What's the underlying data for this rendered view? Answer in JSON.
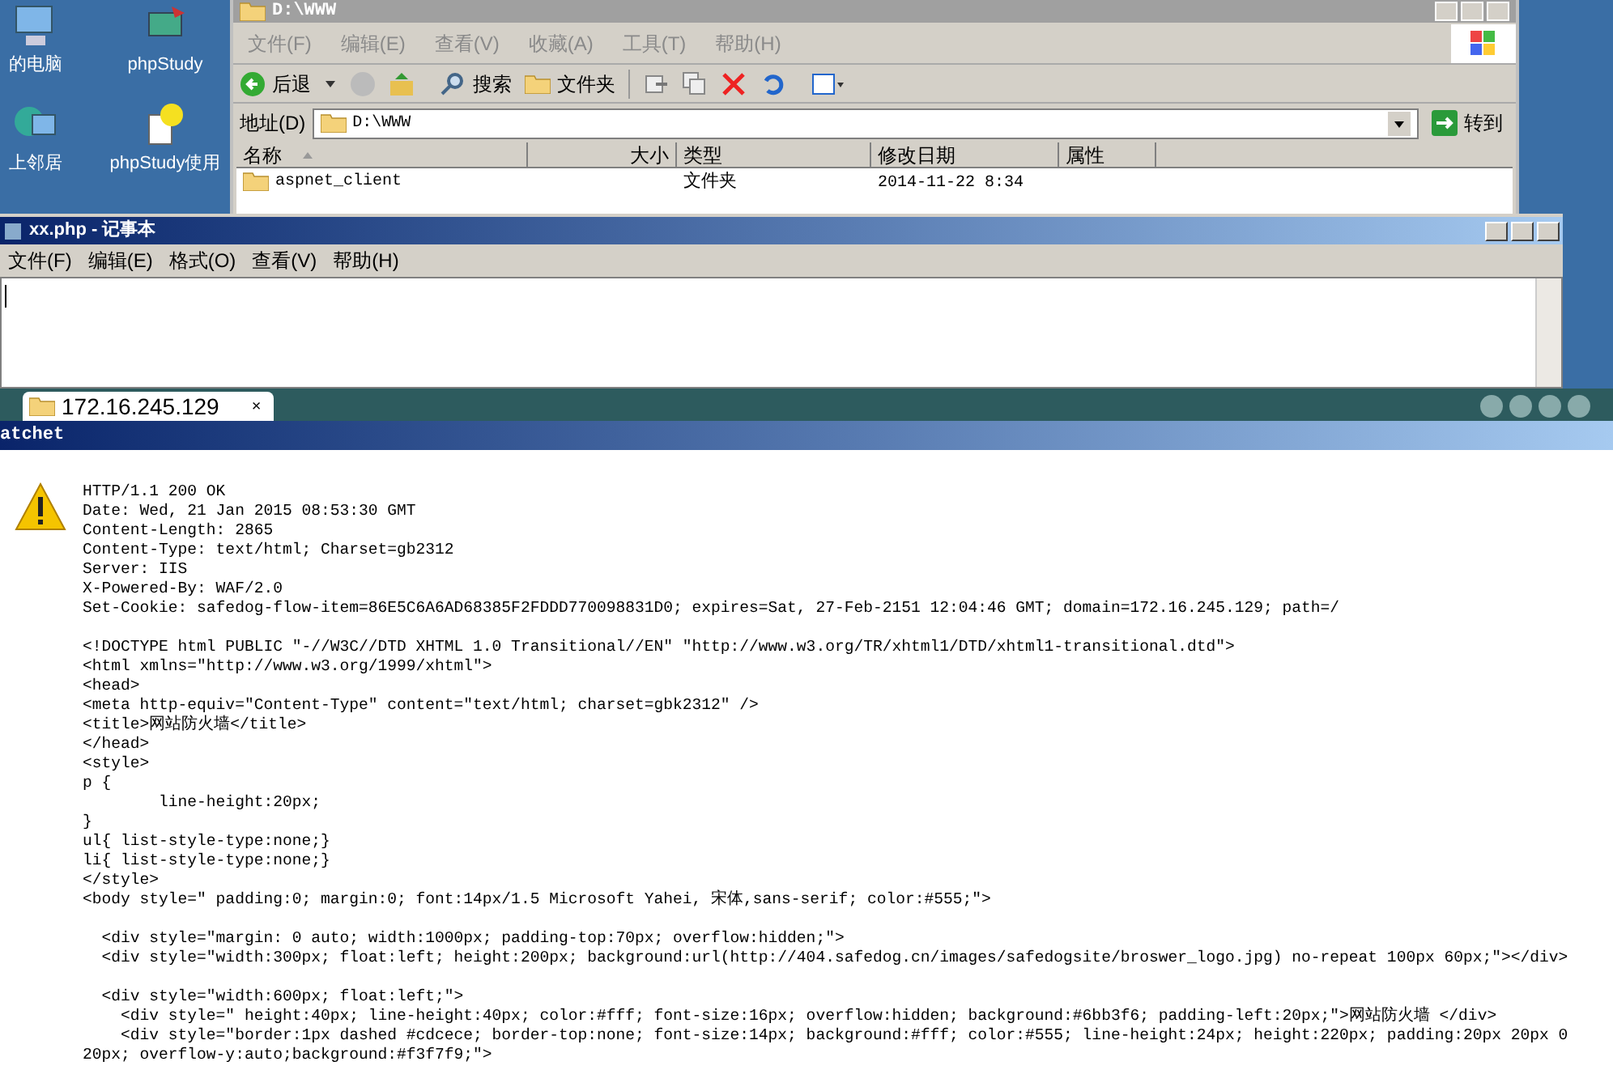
{
  "desktop_icons": [
    {
      "label": "的电脑"
    },
    {
      "label": "phpStudy"
    },
    {
      "label": "上邻居"
    },
    {
      "label": "phpStudy使用"
    }
  ],
  "explorer": {
    "title": "D:\\WWW",
    "menu": [
      "文件(F)",
      "编辑(E)",
      "查看(V)",
      "收藏(A)",
      "工具(T)",
      "帮助(H)"
    ],
    "toolbar": {
      "back": "后退",
      "search": "搜索",
      "folders": "文件夹"
    },
    "address": {
      "label": "地址(D)",
      "value": "D:\\WWW",
      "go": "转到"
    },
    "columns": [
      "名称",
      "大小",
      "类型",
      "修改日期",
      "属性"
    ],
    "rows": [
      {
        "name": "aspnet_client",
        "size": "",
        "type": "文件夹",
        "modified": "2014-11-22 8:34"
      }
    ]
  },
  "notepad": {
    "title": "xx.php - 记事本",
    "menu": [
      "文件(F)",
      "编辑(E)",
      "格式(O)",
      "查看(V)",
      "帮助(H)"
    ]
  },
  "browser": {
    "tab": {
      "label": "172.16.245.129",
      "close": "×"
    },
    "title": "atchet"
  },
  "response": {
    "blocks": [
      [
        "HTTP/1.1 200 OK",
        "Date: Wed, 21 Jan 2015 08:53:30 GMT",
        "Content-Length: 2865",
        "Content-Type: text/html; Charset=gb2312",
        "Server: IIS",
        "X-Powered-By: WAF/2.0",
        "Set-Cookie: safedog-flow-item=86E5C6A6AD68385F2FDDD770098831D0; expires=Sat, 27-Feb-2151 12:04:46 GMT; domain=172.16.245.129; path=/"
      ],
      [
        "<!DOCTYPE html PUBLIC \"-//W3C//DTD XHTML 1.0 Transitional//EN\" \"http://www.w3.org/TR/xhtml1/DTD/xhtml1-transitional.dtd\">",
        "<html xmlns=\"http://www.w3.org/1999/xhtml\">",
        "<head>",
        "<meta http-equiv=\"Content-Type\" content=\"text/html; charset=gbk2312\" />",
        "<title>网站防火墙</title>",
        "</head>",
        "<style>",
        "p {",
        "        line-height:20px;",
        "}",
        "ul{ list-style-type:none;}",
        "li{ list-style-type:none;}",
        "</style>",
        "<body style=\" padding:0; margin:0; font:14px/1.5 Microsoft Yahei, 宋体,sans-serif; color:#555;\">"
      ],
      [
        "  <div style=\"margin: 0 auto; width:1000px; padding-top:70px; overflow:hidden;\">",
        "  <div style=\"width:300px; float:left; height:200px; background:url(http://404.safedog.cn/images/safedogsite/broswer_logo.jpg) no-repeat 100px 60px;\"></div>"
      ],
      [
        "  <div style=\"width:600px; float:left;\">",
        "    <div style=\" height:40px; line-height:40px; color:#fff; font-size:16px; overflow:hidden; background:#6bb3f6; padding-left:20px;\">网站防火墙 </div>",
        "    <div style=\"border:1px dashed #cdcece; border-top:none; font-size:14px; background:#fff; color:#555; line-height:24px; height:220px; padding:20px 20px 0",
        "20px; overflow-y:auto;background:#f3f7f9;\">"
      ]
    ]
  }
}
